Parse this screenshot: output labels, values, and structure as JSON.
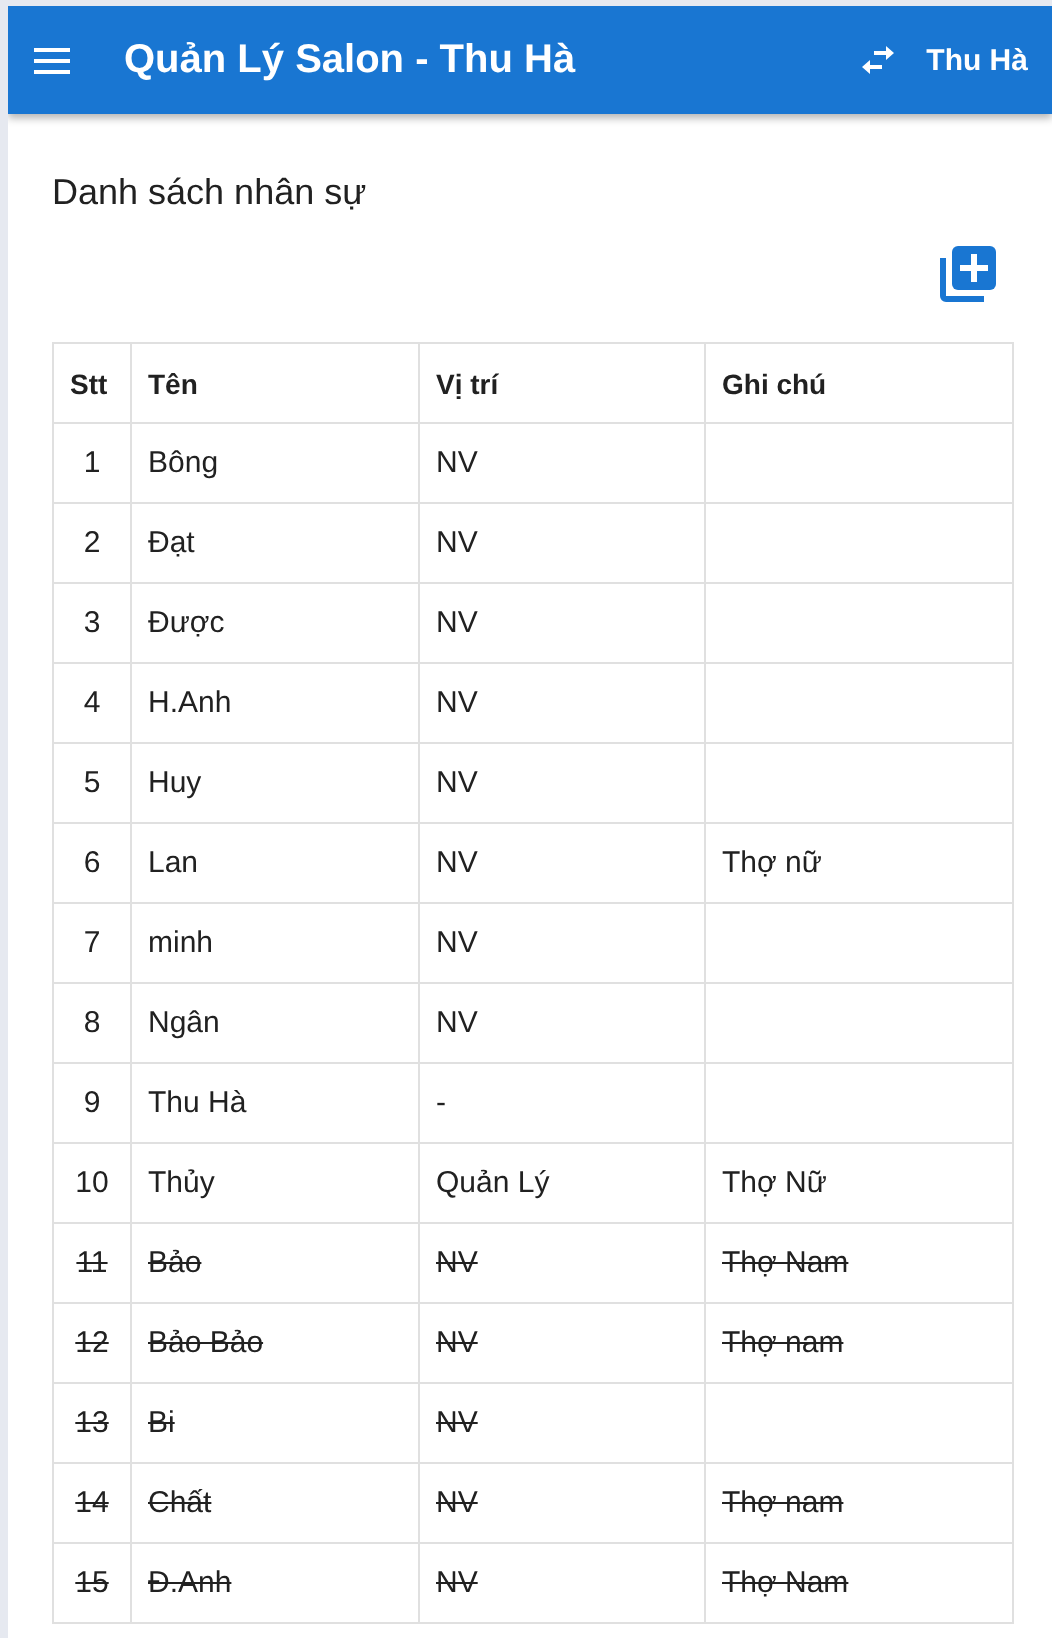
{
  "app_bar": {
    "title": "Quản Lý Salon - Thu Hà",
    "user": "Thu Hà"
  },
  "page": {
    "heading": "Danh sách nhân sự"
  },
  "table": {
    "columns": [
      "Stt",
      "Tên",
      "Vị trí",
      "Ghi chú"
    ],
    "rows": [
      {
        "stt": "1",
        "name": "Bông",
        "position": "NV",
        "note": "",
        "deleted": false
      },
      {
        "stt": "2",
        "name": "Đạt",
        "position": "NV",
        "note": "",
        "deleted": false
      },
      {
        "stt": "3",
        "name": "Được",
        "position": "NV",
        "note": "",
        "deleted": false
      },
      {
        "stt": "4",
        "name": "H.Anh",
        "position": "NV",
        "note": "",
        "deleted": false
      },
      {
        "stt": "5",
        "name": "Huy",
        "position": "NV",
        "note": "",
        "deleted": false
      },
      {
        "stt": "6",
        "name": "Lan",
        "position": "NV",
        "note": "Thợ nữ",
        "deleted": false
      },
      {
        "stt": "7",
        "name": "minh",
        "position": "NV",
        "note": "",
        "deleted": false
      },
      {
        "stt": "8",
        "name": "Ngân",
        "position": "NV",
        "note": "",
        "deleted": false
      },
      {
        "stt": "9",
        "name": "Thu Hà",
        "position": "-",
        "note": "",
        "deleted": false
      },
      {
        "stt": "10",
        "name": "Thủy",
        "position": "Quản Lý",
        "note": "Thợ Nữ",
        "deleted": false
      },
      {
        "stt": "11",
        "name": "Bảo",
        "position": "NV",
        "note": "Thợ Nam",
        "deleted": true
      },
      {
        "stt": "12",
        "name": "Bảo Bảo",
        "position": "NV",
        "note": "Thợ nam",
        "deleted": true
      },
      {
        "stt": "13",
        "name": "Bi",
        "position": "NV",
        "note": "",
        "deleted": true
      },
      {
        "stt": "14",
        "name": "Chất",
        "position": "NV",
        "note": "Thợ nam",
        "deleted": true
      },
      {
        "stt": "15",
        "name": "Đ.Anh",
        "position": "NV",
        "note": "Thợ Nam",
        "deleted": true
      }
    ]
  }
}
